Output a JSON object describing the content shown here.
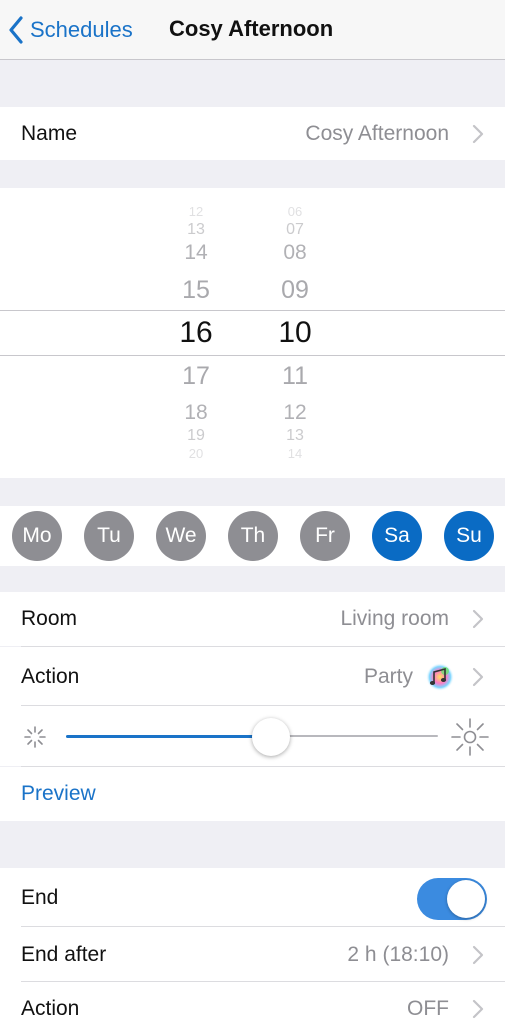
{
  "nav": {
    "back_label": "Schedules",
    "title": "Cosy Afternoon"
  },
  "name_row": {
    "label": "Name",
    "value": "Cosy Afternoon"
  },
  "time_picker": {
    "hours": [
      "12",
      "13",
      "14",
      "15",
      "16",
      "17",
      "18",
      "19",
      "20"
    ],
    "minutes": [
      "06",
      "07",
      "08",
      "09",
      "10",
      "11",
      "12",
      "13",
      "14"
    ],
    "selected_hour": "16",
    "selected_minute": "10"
  },
  "days": [
    {
      "label": "Mo",
      "active": false
    },
    {
      "label": "Tu",
      "active": false
    },
    {
      "label": "We",
      "active": false
    },
    {
      "label": "Th",
      "active": false
    },
    {
      "label": "Fr",
      "active": false
    },
    {
      "label": "Sa",
      "active": true
    },
    {
      "label": "Su",
      "active": true
    }
  ],
  "room_row": {
    "label": "Room",
    "value": "Living room"
  },
  "action_row": {
    "label": "Action",
    "value": "Party",
    "icon": "party-music-icon"
  },
  "brightness": {
    "level": 0.55,
    "min_icon": "dim-sun-icon",
    "max_icon": "bright-sun-icon"
  },
  "preview_label": "Preview",
  "end_row": {
    "label": "End",
    "enabled": true
  },
  "end_after_row": {
    "label": "End after",
    "value": "2 h (18:10)"
  },
  "end_action_row": {
    "label": "Action",
    "value": "OFF"
  },
  "colors": {
    "accent": "#1a73c8",
    "day_active": "#0a6bc4",
    "day_inactive": "#8e8e93",
    "toggle_on": "#3b8be0"
  }
}
